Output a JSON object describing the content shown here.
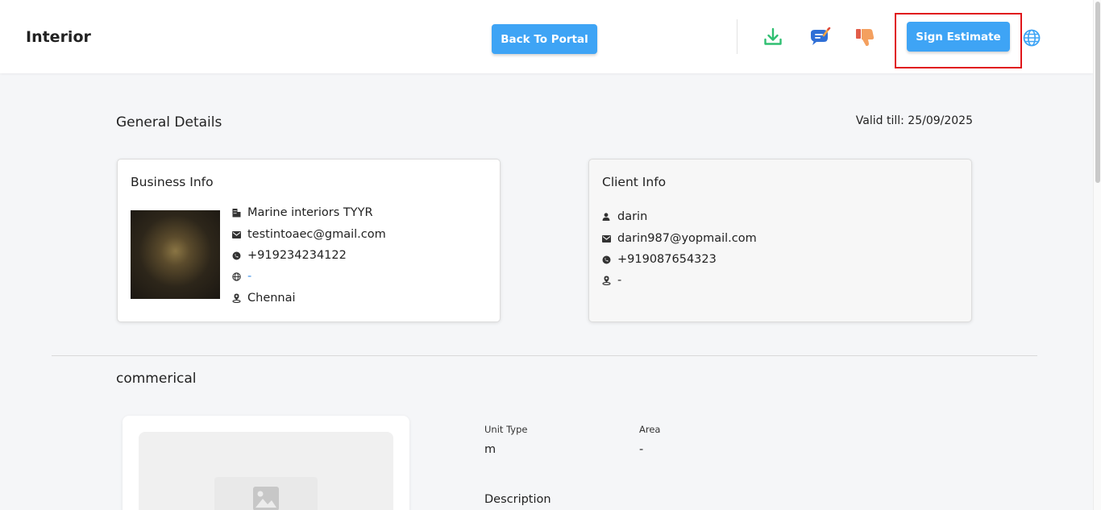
{
  "header": {
    "title": "Interior",
    "back_button": "Back To Portal",
    "sign_button": "Sign Estimate",
    "icons": [
      "download-icon",
      "chat-icon",
      "dislike-icon",
      "globe-icon"
    ]
  },
  "general": {
    "title": "General Details",
    "valid_till": "Valid till: 25/09/2025"
  },
  "business": {
    "title": "Business Info",
    "name": "Marine interiors TYYR",
    "email": "testintoaec@gmail.com",
    "phone": "+919234234122",
    "website": "-",
    "location": "Chennai"
  },
  "client": {
    "title": "Client Info",
    "name": "darin",
    "email": "darin987@yopmail.com",
    "phone": "+919087654323",
    "location": "-"
  },
  "item": {
    "title": "commerical",
    "unit_type_label": "Unit Type",
    "unit_type_value": "m",
    "area_label": "Area",
    "area_value": "-",
    "description_label": "Description"
  },
  "colors": {
    "accent": "#3ea4f5",
    "highlight": "#e0161b",
    "download": "#2fbf71",
    "link": "#3a8ee6"
  }
}
